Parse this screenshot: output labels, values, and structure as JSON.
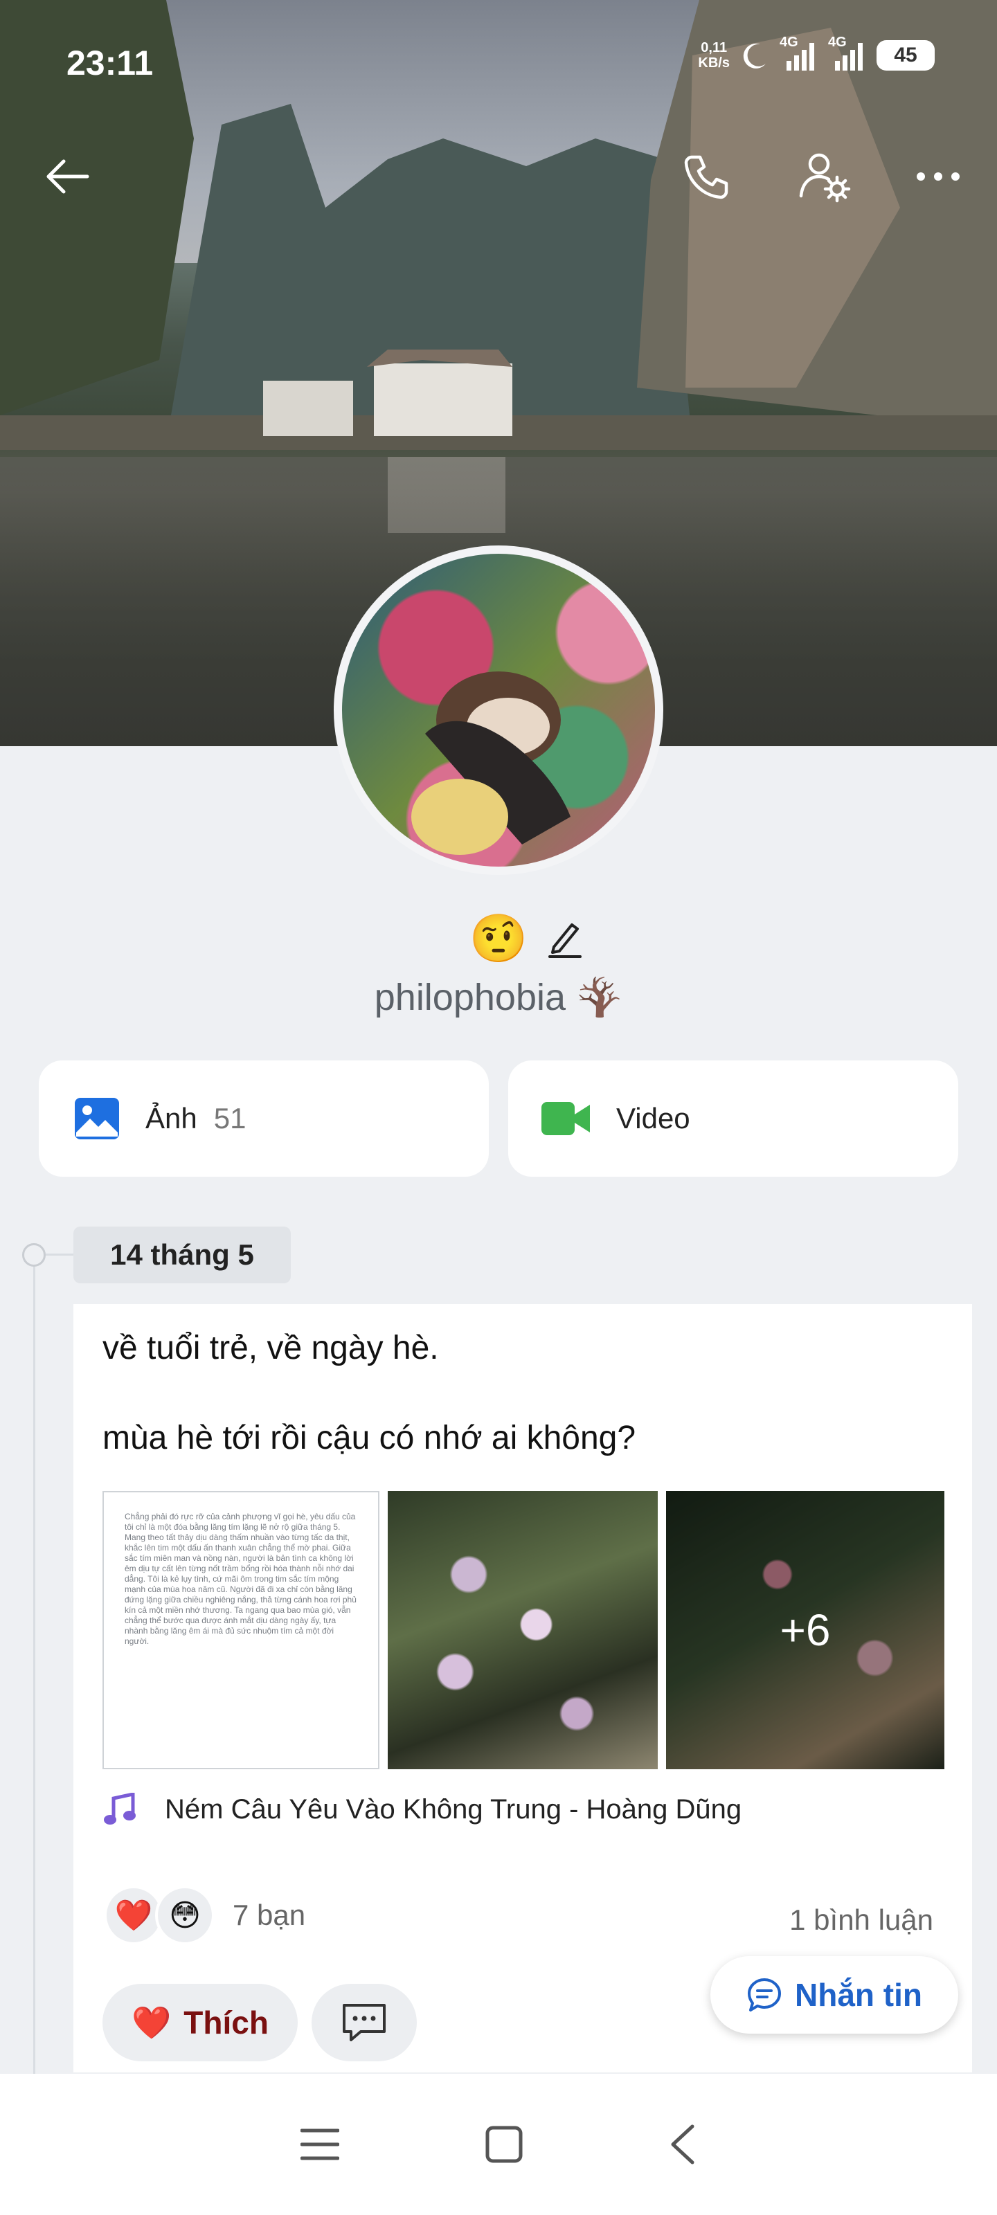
{
  "status_bar": {
    "time": "23:11",
    "net_speed_value": "0,11",
    "net_speed_unit": "KB/s",
    "network_1": "4G",
    "network_2": "4G",
    "battery": "45"
  },
  "profile": {
    "status_emoji": "🤨",
    "username": "philophobia 🪾"
  },
  "media": {
    "photos_label": "Ảnh",
    "photos_count": "51",
    "video_label": "Video"
  },
  "post": {
    "date": "14 tháng 5",
    "line1": "về tuổi trẻ, về ngày hè.",
    "line2": "mùa hè tới rồi cậu có nhớ ai không?",
    "photo1_text": "Chẳng phải đó rực rỡ của cảnh phượng vĩ gọi hè, yêu dấu của tôi chỉ là một đóa bằng lăng tím lặng lẽ nở rộ giữa tháng 5. Mang theo tất thảy dịu dàng thấm nhuần vào từng tấc da thịt, khắc lên tim một dấu ấn thanh xuân chẳng thể mờ phai. Giữa sắc tím miên man và nồng nàn, người là bản tình ca không lời êm dịu tự cất lên từng nốt trầm bổng rồi hóa thành nỗi nhớ dai dẳng. Tôi là kẻ lụy tình, cứ mãi ôm trong tim sắc tím mộng mạnh của mùa hoa năm cũ. Người đã đi xa chỉ còn bằng lăng đứng lặng giữa chiều nghiêng nắng, thả từng cánh hoa rơi phủ kín cả một miền nhớ thương. Ta ngang qua bao mùa gió, vẫn chẳng thể bước qua được ánh mắt dịu dàng ngày ấy, tựa nhành bằng lăng êm ái mà đủ sức nhuộm tím cả một đời người.",
    "more_photos": "+6",
    "song": "Ném Câu Yêu Vào Không Trung - Hoàng Dũng",
    "reaction_1": "❤️",
    "reaction_2": "😳",
    "reactions_count": "7 bạn",
    "comments": "1 bình luận",
    "like_icon": "❤️",
    "like_label": "Thích"
  },
  "message_button": "Nhắn tin",
  "colors": {
    "accent_blue": "#1f62c8",
    "photo_icon_blue": "#1e6fe0",
    "video_icon_green": "#3fb54f",
    "music_purple": "#7a5cd6",
    "page_bg": "#eef0f3"
  }
}
